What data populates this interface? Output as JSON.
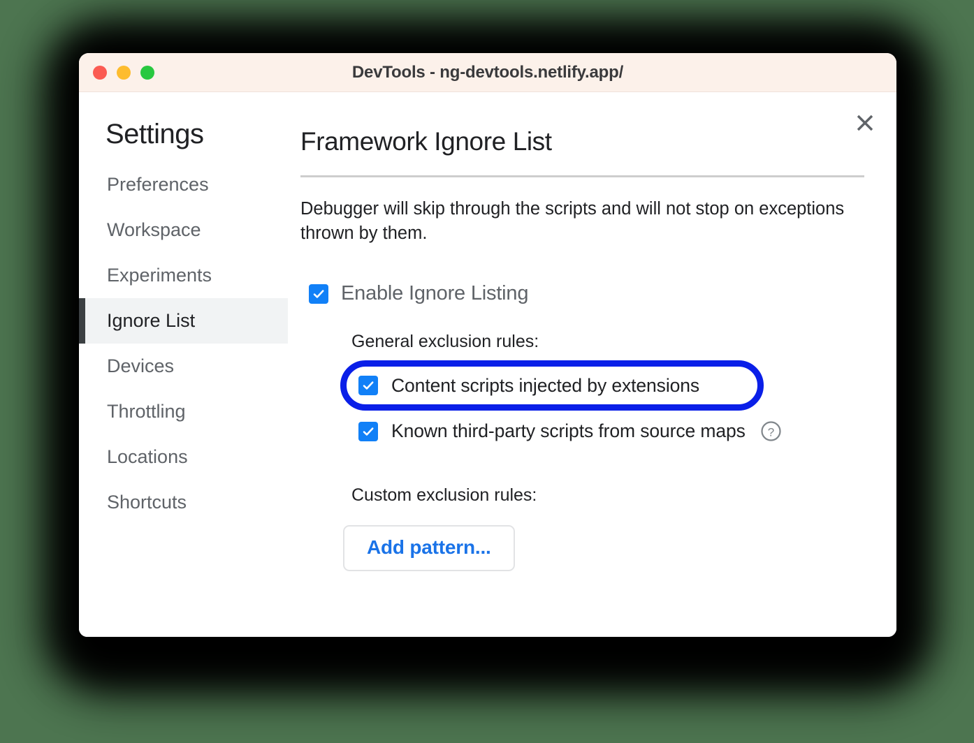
{
  "window": {
    "title": "DevTools - ng-devtools.netlify.app/",
    "traffic_lights": [
      {
        "name": "close",
        "color": "#fb5b52"
      },
      {
        "name": "minimize",
        "color": "#fdbc2e"
      },
      {
        "name": "maximize",
        "color": "#28c840"
      }
    ]
  },
  "sidebar": {
    "heading": "Settings",
    "items": [
      {
        "label": "Preferences",
        "selected": false
      },
      {
        "label": "Workspace",
        "selected": false
      },
      {
        "label": "Experiments",
        "selected": false
      },
      {
        "label": "Ignore List",
        "selected": true
      },
      {
        "label": "Devices",
        "selected": false
      },
      {
        "label": "Throttling",
        "selected": false
      },
      {
        "label": "Locations",
        "selected": false
      },
      {
        "label": "Shortcuts",
        "selected": false
      }
    ]
  },
  "main": {
    "panel_title": "Framework Ignore List",
    "description": "Debugger will skip through the scripts and will not stop on exceptions thrown by them.",
    "close_icon": "close-icon",
    "enable_ignore_listing": {
      "label": "Enable Ignore Listing",
      "checked": true
    },
    "general_rules_label": "General exclusion rules:",
    "general_rules": [
      {
        "label": "Content scripts injected by extensions",
        "checked": true,
        "highlighted": true,
        "has_help": false
      },
      {
        "label": "Known third-party scripts from source maps",
        "checked": true,
        "highlighted": false,
        "has_help": true,
        "help_icon": "help-circle-icon"
      }
    ],
    "custom_rules_label": "Custom exclusion rules:",
    "add_pattern_label": "Add pattern..."
  },
  "colors": {
    "page_background": "#4d7550",
    "titlebar_background": "#fcf1ea",
    "checkbox_blue": "#1180f7",
    "annotation_blue": "#0a1fe8",
    "link_blue": "#1a73e8",
    "selected_nav_background": "#f1f3f4",
    "selected_nav_accent": "#3c4043",
    "text_primary": "#202124",
    "text_secondary": "#5f6368",
    "divider": "#cdcdcd"
  }
}
